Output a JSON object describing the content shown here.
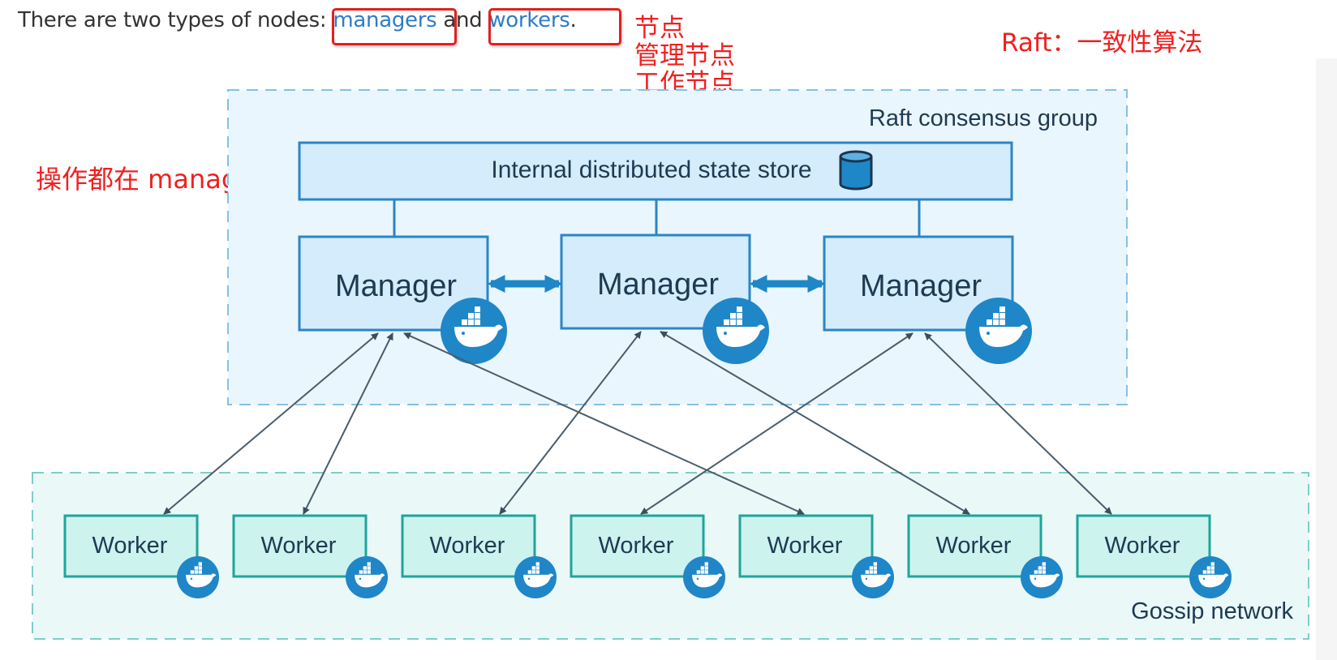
{
  "intro": {
    "prefix": "There are two types of nodes: ",
    "managers_link": "managers",
    "middle": " and ",
    "workers_link": "workers",
    "suffix": "."
  },
  "annotations": {
    "nodes_line1": "节点",
    "nodes_line2": "管理节点",
    "nodes_line3": "工作节点",
    "raft": "Raft：一致性算法",
    "operations": "操作都在 manager"
  },
  "diagram": {
    "raft_group_label": "Raft consensus group",
    "state_store_label": "Internal distributed state store",
    "managers": [
      "Manager",
      "Manager",
      "Manager"
    ],
    "workers": [
      "Worker",
      "Worker",
      "Worker",
      "Worker",
      "Worker",
      "Worker",
      "Worker"
    ],
    "gossip_label": "Gossip network"
  },
  "colors": {
    "annotation_red": "#e02020",
    "link_blue": "#2f7cc9",
    "manager_fill": "#d4ecfb",
    "manager_stroke": "#2a86c6",
    "worker_fill": "#cdf3ef",
    "worker_stroke": "#1fa59a",
    "docker_blue": "#1f86c8"
  },
  "icons": {
    "database": "database-icon",
    "docker": "docker-whale-icon"
  }
}
